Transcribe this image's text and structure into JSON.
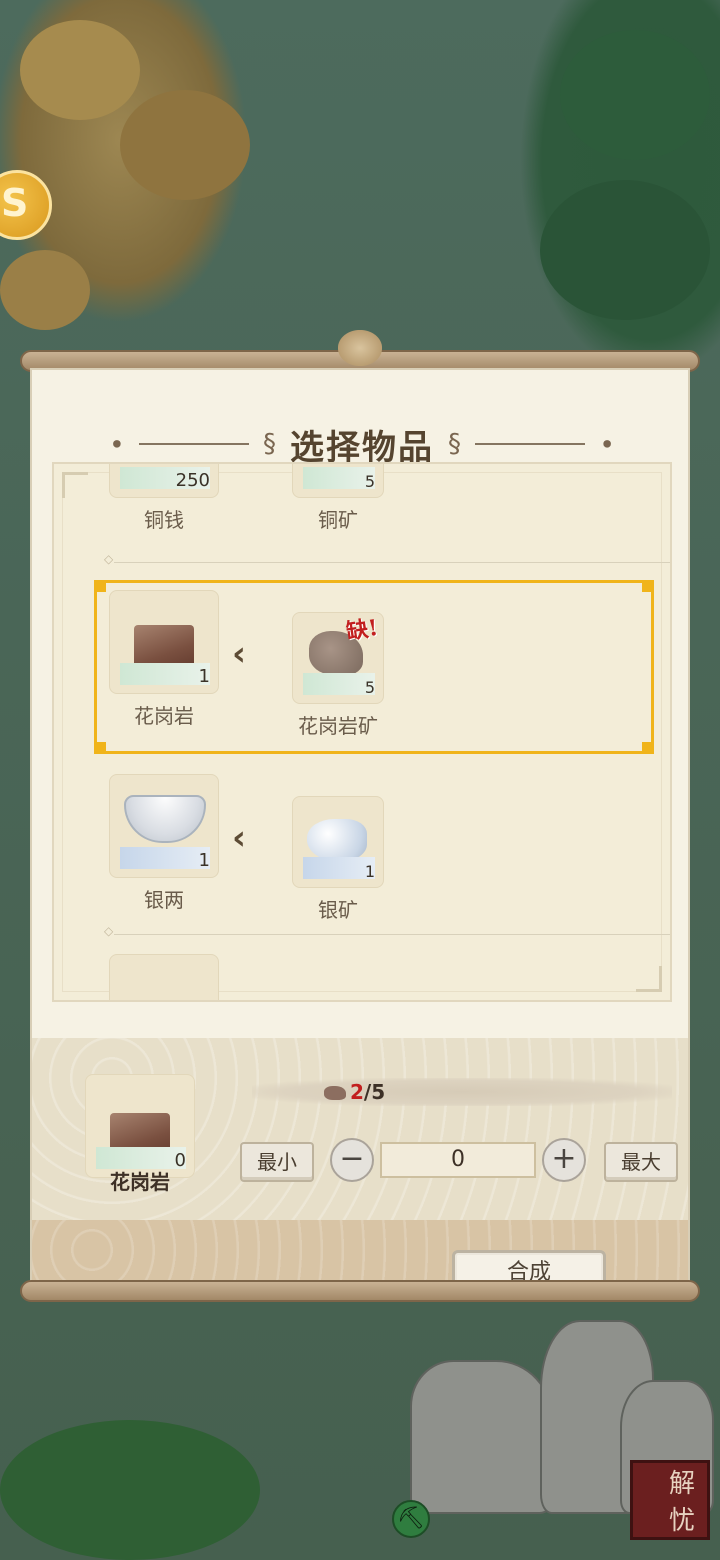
{
  "dialog": {
    "title": "选择物品",
    "craft_label": "合成"
  },
  "recipes": [
    {
      "product": {
        "name": "铜钱",
        "count": "250"
      },
      "material": {
        "name": "铜矿",
        "count": "5"
      }
    },
    {
      "product": {
        "name": "花岗岩",
        "count": "1"
      },
      "material": {
        "name": "花岗岩矿",
        "count": "5",
        "badge": "缺!"
      },
      "selected": true
    },
    {
      "product": {
        "name": "银两",
        "count": "1"
      },
      "material": {
        "name": "银矿",
        "count": "1"
      }
    }
  ],
  "craft_panel": {
    "result_name": "花岗岩",
    "result_count": "0",
    "requirement_current": "2",
    "requirement_total": "/5",
    "min_label": "最小",
    "max_label": "最大",
    "minus_symbol": "−",
    "plus_symbol": "+",
    "quantity": "0"
  },
  "hud": {
    "seal_text_1": "解",
    "seal_text_2": "忧",
    "coin_icon_glyph": "S"
  },
  "colors": {
    "selection_border": "#f0b41a",
    "missing_red": "#c21f1f"
  },
  "icons": [
    "coin-icon",
    "pickaxe-icon",
    "arrow-left-icon",
    "minus-icon",
    "plus-icon"
  ]
}
